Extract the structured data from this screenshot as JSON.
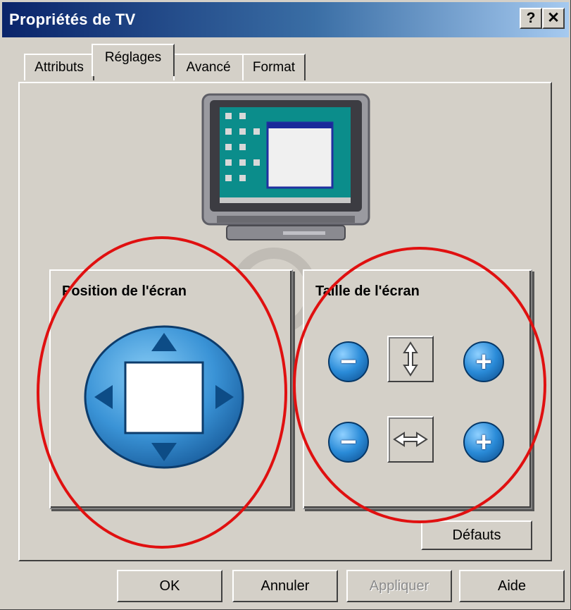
{
  "window": {
    "title": "Propriétés de TV",
    "help_button": "?",
    "close_button": "✕"
  },
  "tabs": [
    {
      "label": "Attributs"
    },
    {
      "label": "Réglages"
    },
    {
      "label": "Avancé"
    },
    {
      "label": "Format"
    }
  ],
  "position_group": {
    "title": "Position de l'écran"
  },
  "size_group": {
    "title": "Taille de l'écran",
    "minus": "−",
    "plus": "+"
  },
  "buttons": {
    "defaults": "Défauts",
    "ok": "OK",
    "cancel": "Annuler",
    "apply": "Appliquer",
    "help": "Aide"
  },
  "colors": {
    "accent_blue": "#2a8bd8",
    "highlight_red": "#e01010",
    "face": "#d4d0c8"
  }
}
